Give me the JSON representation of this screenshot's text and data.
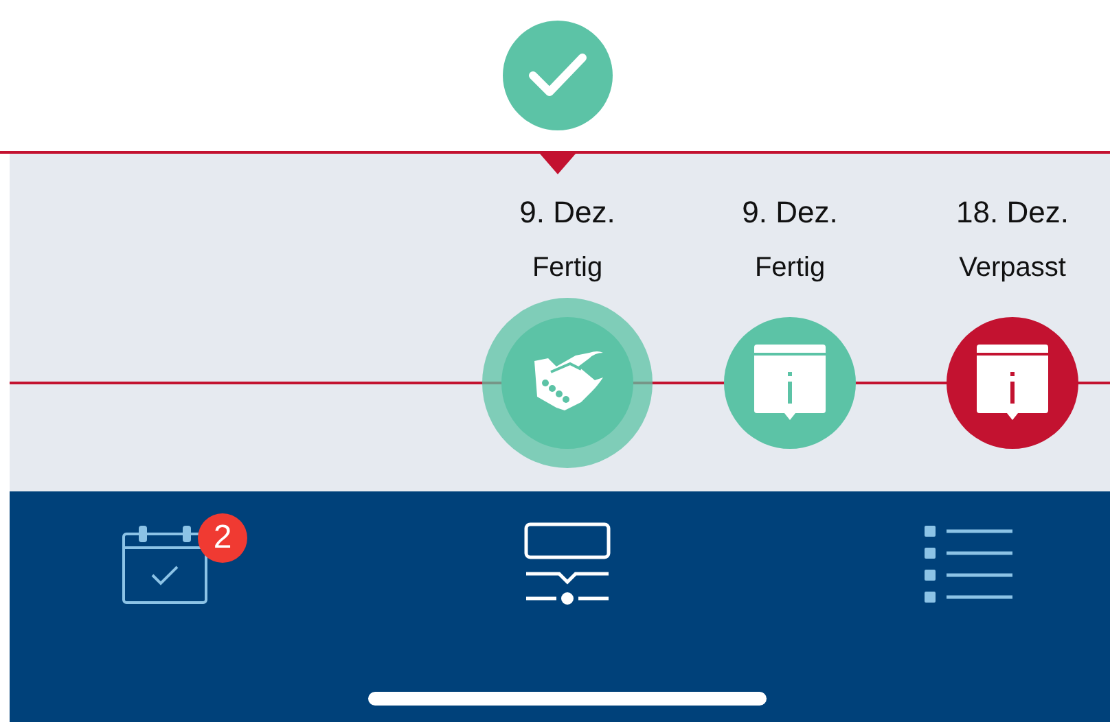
{
  "events": [
    {
      "date": "9. Dez.",
      "status_label": "Fertig",
      "color": "#5cc3a6",
      "kind": "meeting",
      "selected": true
    },
    {
      "date": "9. Dez.",
      "status_label": "Fertig",
      "color": "#5cc3a6",
      "kind": "notice",
      "selected": false
    },
    {
      "date": "18. Dez.",
      "status_label": "Verpasst",
      "color": "#c31230",
      "kind": "notice",
      "selected": false
    }
  ],
  "tab_bar": {
    "tabs": [
      {
        "kind": "calendar",
        "selected": false,
        "badge": "2"
      },
      {
        "kind": "timeline",
        "selected": true
      },
      {
        "kind": "list",
        "selected": false
      }
    ]
  }
}
